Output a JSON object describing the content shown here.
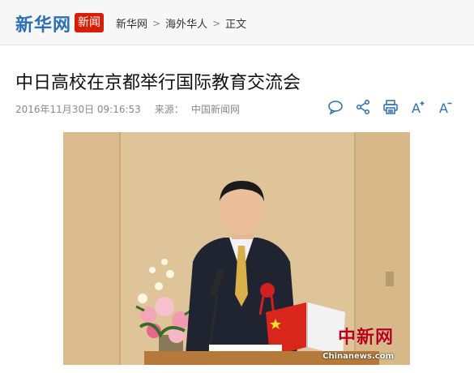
{
  "header": {
    "logo_text": "新华网",
    "logo_badge": "新闻",
    "breadcrumb": [
      "新华网",
      "海外华人",
      "正文"
    ],
    "separator": ">"
  },
  "article": {
    "title": "中日高校在京都举行国际教育交流会",
    "datetime": "2016年11月30日 09:16:53",
    "source_label": "来源：",
    "source": "中国新闻网"
  },
  "toolbar": {
    "icons": [
      "comment-icon",
      "share-icon",
      "print-icon",
      "font-increase-icon",
      "font-decrease-icon"
    ],
    "font_up": "A",
    "font_down": "A",
    "accent_color": "#2b6fb6"
  },
  "photo": {
    "watermark": "中新网",
    "watermark_sub": "Chinanews.com"
  }
}
